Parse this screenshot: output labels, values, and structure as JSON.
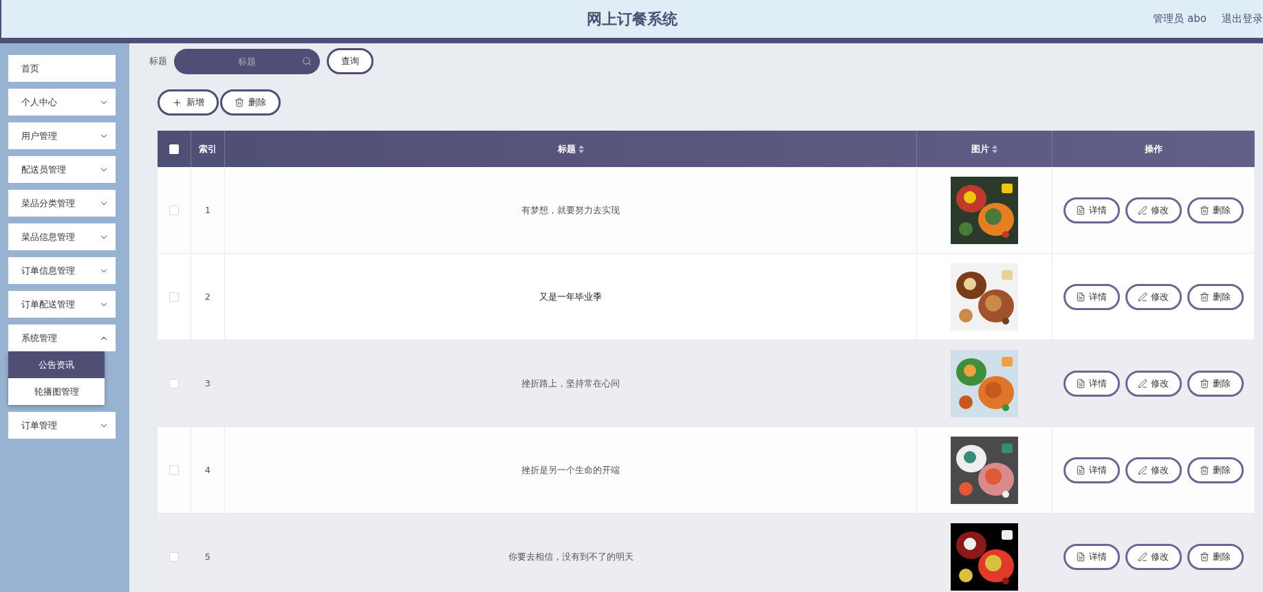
{
  "header": {
    "title": "网上订餐系统",
    "user": "管理员 abo",
    "logout": "退出登录"
  },
  "sidebar": {
    "items": [
      {
        "label": "首页",
        "kind": "link"
      },
      {
        "label": "个人中心",
        "kind": "menu",
        "expanded": false
      },
      {
        "label": "用户管理",
        "kind": "menu",
        "expanded": false
      },
      {
        "label": "配送员管理",
        "kind": "menu",
        "expanded": false
      },
      {
        "label": "菜品分类管理",
        "kind": "menu",
        "expanded": false
      },
      {
        "label": "菜品信息管理",
        "kind": "menu",
        "expanded": false
      },
      {
        "label": "订单信息管理",
        "kind": "menu",
        "expanded": false
      },
      {
        "label": "订单配送管理",
        "kind": "menu",
        "expanded": false
      },
      {
        "label": "系统管理",
        "kind": "menu",
        "expanded": true,
        "children": [
          {
            "label": "公告资讯",
            "selected": true
          },
          {
            "label": "轮播图管理",
            "selected": false
          }
        ]
      },
      {
        "label": "订单管理",
        "kind": "menu",
        "expanded": false
      }
    ]
  },
  "search": {
    "label": "标题",
    "placeholder": "标题",
    "button": "查询"
  },
  "toolbar": [
    {
      "label": "新增",
      "kind": "add"
    },
    {
      "label": "删除",
      "kind": "delete"
    }
  ],
  "table": {
    "select_all": {
      "checked": false
    },
    "columns": [
      {
        "label": "索引",
        "sortable": false
      },
      {
        "label": "标题",
        "sortable": true
      },
      {
        "label": "图片",
        "sortable": true
      },
      {
        "label": "操作",
        "sortable": false
      }
    ],
    "rows": [
      {
        "index": "1",
        "title": "有梦想，就要努力去实现",
        "checked": false,
        "hovered": false,
        "shaded": false,
        "picture": {
          "kind": "picture"
        },
        "actions": [
          {
            "label": "详情",
            "kind": "detail"
          },
          {
            "label": "修改",
            "kind": "edit"
          },
          {
            "label": "删除",
            "kind": "delete"
          }
        ]
      },
      {
        "index": "2",
        "title": "又是一年毕业季",
        "checked": false,
        "hovered": true,
        "shaded": false,
        "picture": {
          "kind": "picture"
        },
        "actions": [
          {
            "label": "详情",
            "kind": "detail"
          },
          {
            "label": "修改",
            "kind": "edit"
          },
          {
            "label": "删除",
            "kind": "delete"
          }
        ]
      },
      {
        "index": "3",
        "title": "挫折路上，坚持常在心间",
        "checked": false,
        "hovered": false,
        "shaded": true,
        "picture": {
          "kind": "picture"
        },
        "actions": [
          {
            "label": "详情",
            "kind": "detail"
          },
          {
            "label": "修改",
            "kind": "edit"
          },
          {
            "label": "删除",
            "kind": "delete"
          }
        ]
      },
      {
        "index": "4",
        "title": "挫折是另一个生命的开端",
        "checked": false,
        "hovered": false,
        "shaded": false,
        "picture": {
          "kind": "picture"
        },
        "actions": [
          {
            "label": "详情",
            "kind": "detail"
          },
          {
            "label": "修改",
            "kind": "edit"
          },
          {
            "label": "删除",
            "kind": "delete"
          }
        ]
      },
      {
        "index": "5",
        "title": "你要去相信，没有到不了的明天",
        "checked": false,
        "hovered": false,
        "shaded": true,
        "picture": {
          "kind": "picture"
        },
        "actions": [
          {
            "label": "详情",
            "kind": "detail"
          },
          {
            "label": "修改",
            "kind": "edit"
          },
          {
            "label": "删除",
            "kind": "delete"
          }
        ]
      }
    ]
  }
}
